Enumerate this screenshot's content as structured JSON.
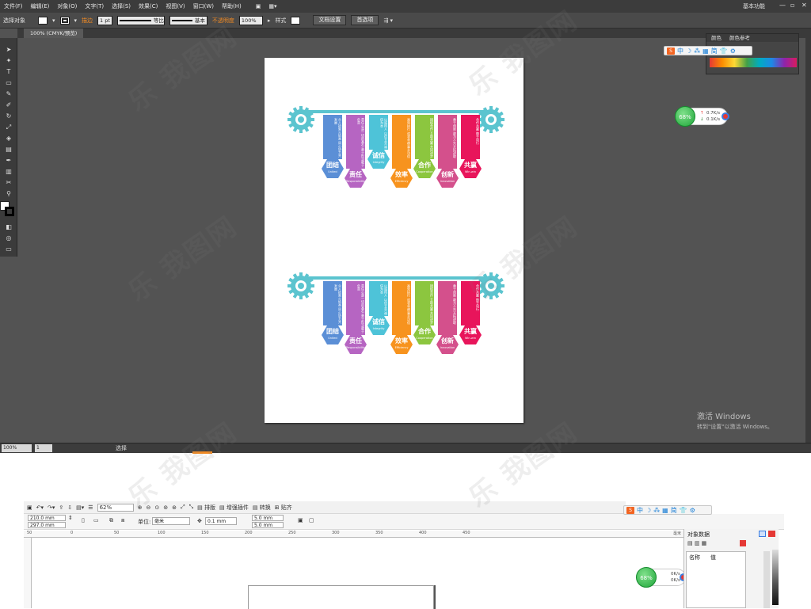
{
  "ai": {
    "menu": [
      "文件(F)",
      "编辑(E)",
      "对象(O)",
      "文字(T)",
      "选择(S)",
      "效果(C)",
      "视图(V)",
      "窗口(W)",
      "帮助(H)"
    ],
    "workspace_label": "基本功能",
    "control": {
      "selection_label": "选择对象",
      "stroke_label": "描边",
      "stroke_value": "1 pt",
      "profile_uniform": "等比",
      "brush_basic": "基本",
      "opacity_label": "不透明度",
      "opacity_value": "100%",
      "style_label": "样式",
      "doc_setup_button": "文档设置",
      "preferences_button": "首选项"
    },
    "doc_tab": "100% (CMYK/预览)",
    "statusbar": {
      "zoom": "100%",
      "page": "1",
      "tool": "选择"
    },
    "color_panel": {
      "tab_color": "颜色",
      "tab_guide": "颜色参考"
    }
  },
  "ime": {
    "chars": [
      "中",
      "☽",
      "⁂",
      "▦",
      "简",
      "👕",
      "⚙"
    ]
  },
  "net_monitor": {
    "percent": "68%",
    "up": "0.7K/s",
    "down": "0.1K/s"
  },
  "net_monitor2": {
    "percent": "68%",
    "up": "0K/s",
    "down": "0K/s"
  },
  "windows_watermark": {
    "line1": "激活 Windows",
    "line2": "转到\"设置\"以激活 Windows。"
  },
  "infographic": {
    "tags": [
      {
        "title": "团结",
        "en": "United",
        "color": "#5b8fd6",
        "text": "众人拾柴火焰高 同心协力共发展",
        "drop": 1
      },
      {
        "title": "责任",
        "en": "Responsibility",
        "color": "#b665c2",
        "text": "责任心是一切的基石 勇于担当敢于负责",
        "drop": 2
      },
      {
        "title": "诚信",
        "en": "Integrity",
        "color": "#4ec3d8",
        "text": "以诚待人 以信立业 诚信为本",
        "drop": 0
      },
      {
        "title": "效率",
        "en": "Efficiency",
        "color": "#f7931e",
        "text": "高效执行 追求卓越 事半功倍",
        "drop": 2
      },
      {
        "title": "合作",
        "en": "Cooperation",
        "color": "#8cc63f",
        "text": "团结合作 互助共赢 共同进步",
        "drop": 1
      },
      {
        "title": "创新",
        "en": "Innovation",
        "color": "#d4508c",
        "text": "勇于创新 敢为人先 开拓进取",
        "drop": 2
      },
      {
        "title": "共赢",
        "en": "Win-win",
        "color": "#e8155b",
        "text": "合作共赢 携手同行",
        "drop": 1
      }
    ]
  },
  "cd": {
    "zoom": "62%",
    "menu_items": [
      "排版",
      "增强插件",
      "转换",
      "贴齐"
    ],
    "width": "210.0 mm",
    "height": "297.0 mm",
    "unit_label": "单位:",
    "unit": "毫米",
    "nudge": "0.1 mm",
    "dup_x": "5.0 mm",
    "dup_y": "5.0 mm",
    "ruler_unit": "毫米",
    "ruler_ticks": [
      "50",
      "0",
      "50",
      "100",
      "150",
      "200",
      "250",
      "300",
      "350",
      "400",
      "450"
    ],
    "panel_title": "对象数据",
    "col_name": "名称",
    "col_value": "值"
  }
}
